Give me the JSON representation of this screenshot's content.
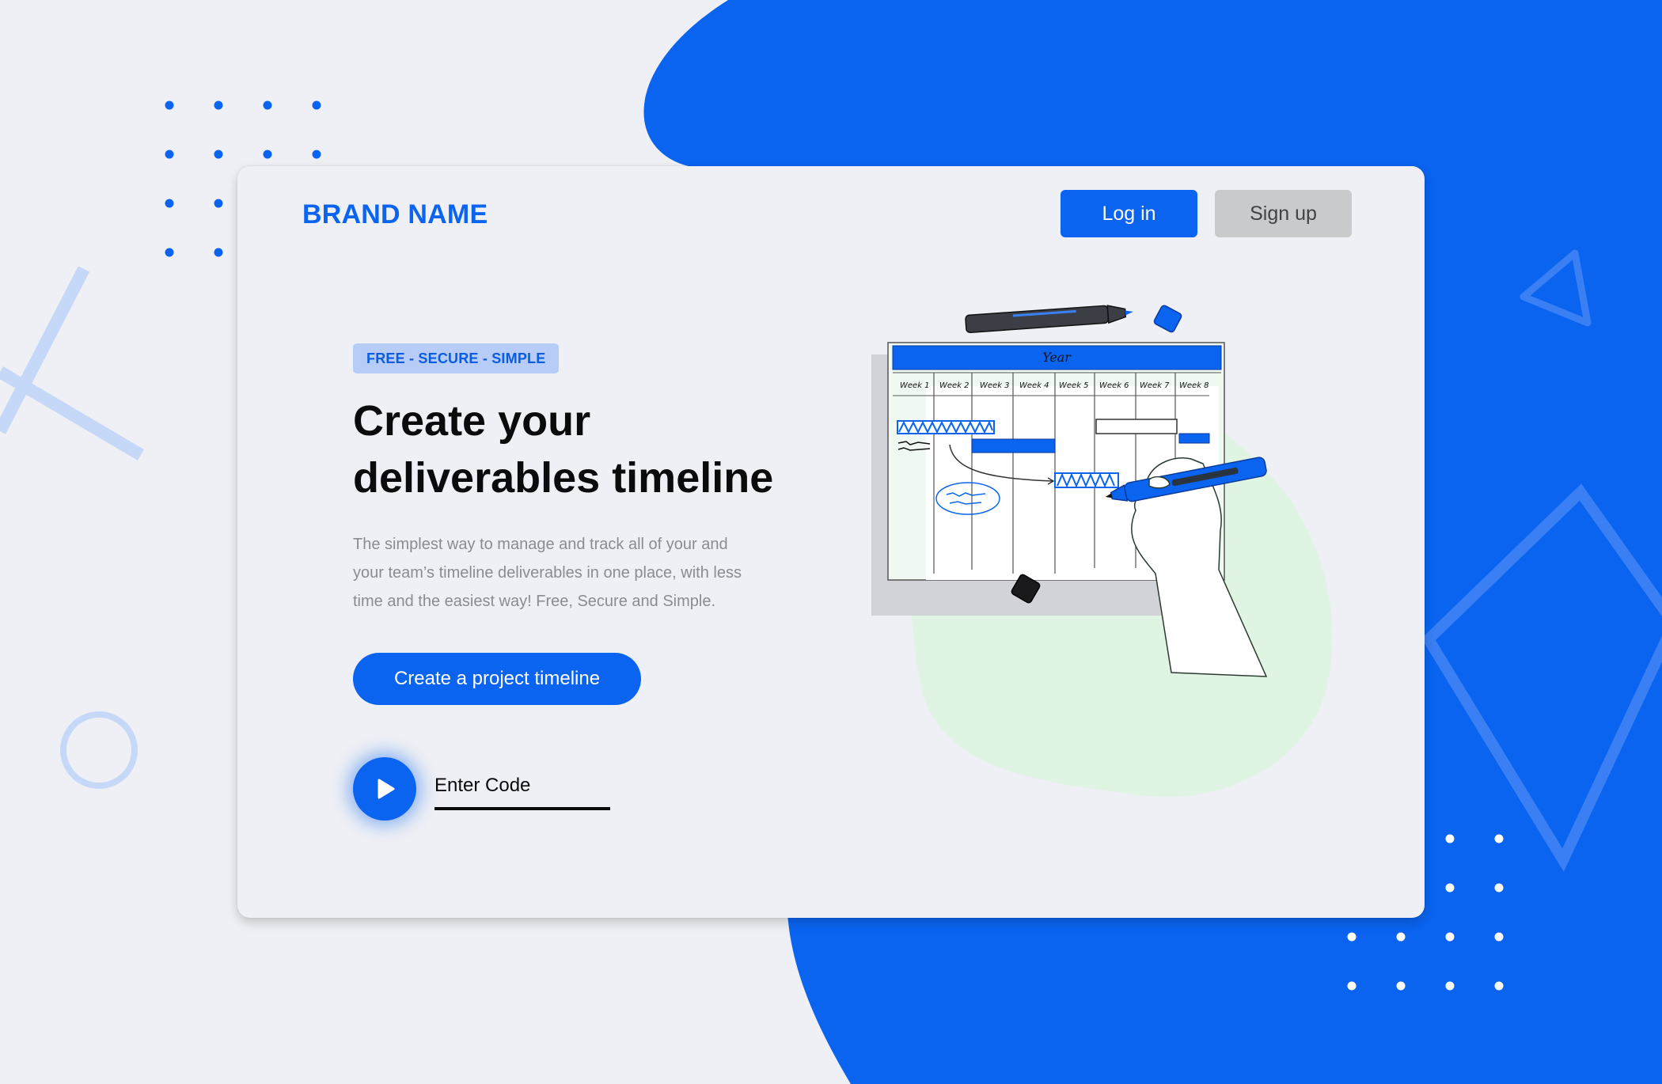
{
  "colors": {
    "accent": "#0a64f0",
    "background": "#eef0f5",
    "secondary_button": "#c9cacc",
    "illustration_green": "#dff4e2"
  },
  "header": {
    "brand": "BRAND NAME",
    "login_label": "Log in",
    "signup_label": "Sign up"
  },
  "hero": {
    "badge": "FREE - SECURE - SIMPLE",
    "headline": [
      "Create your",
      "deliverables timeline"
    ],
    "description": [
      "The simplest way to manage and track all of your and",
      "your team’s timeline deliverables in one place, with less",
      "time and the easiest way! Free, Secure and Simple."
    ],
    "cta_label": "Create a project timeline",
    "code_placeholder": "Enter Code"
  },
  "illustration": {
    "year_label": "Year",
    "weeks": [
      "Week 1",
      "Week 2",
      "Week 3",
      "Week 4",
      "Week 5",
      "Week 6",
      "Week 7",
      "Week 8"
    ]
  },
  "icons": {
    "play": "play-icon"
  }
}
